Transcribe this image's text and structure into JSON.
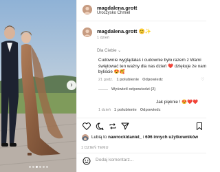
{
  "post": {
    "author": "magdalena.grott",
    "location": "Uroczysko Chmiel",
    "caption_author": "magdalena.grott",
    "caption_time": "1 dzień",
    "carousel_dots": 6,
    "carousel_active": 2
  },
  "comments": {
    "filter_label": "Dla Ciebie",
    "first": {
      "text": "Cudownie wyglądałaś i cudownie było razem z Wami świętować ten ważny dla nas dzień ❤️ dziękuje że nami byliście 😍🥰",
      "time": "21 godz.",
      "likes": "1 polubienie",
      "reply": "Odpowiedz"
    },
    "show_replies": "Wyświetl odpowiedzi (2)",
    "second": {
      "text": "Jak pięknie ! 😍❤️❤️",
      "time": "1 dzień",
      "likes": "1 polubienie",
      "reply": "Odpowiedz"
    }
  },
  "footer": {
    "likes_prefix": "Lubią to",
    "likes_user": "nawrockidaniel_",
    "likes_mid": "i",
    "likes_count": "606 innych użytkowników",
    "date": "1 DZIEŃ TEMU",
    "add_comment_placeholder": "Dodaj komentarz..."
  },
  "icons": {
    "like": "heart-icon",
    "comment": "comment-icon",
    "share": "share-icon",
    "more": "more-icon",
    "save": "bookmark-icon",
    "emoji": "smiley-icon"
  }
}
